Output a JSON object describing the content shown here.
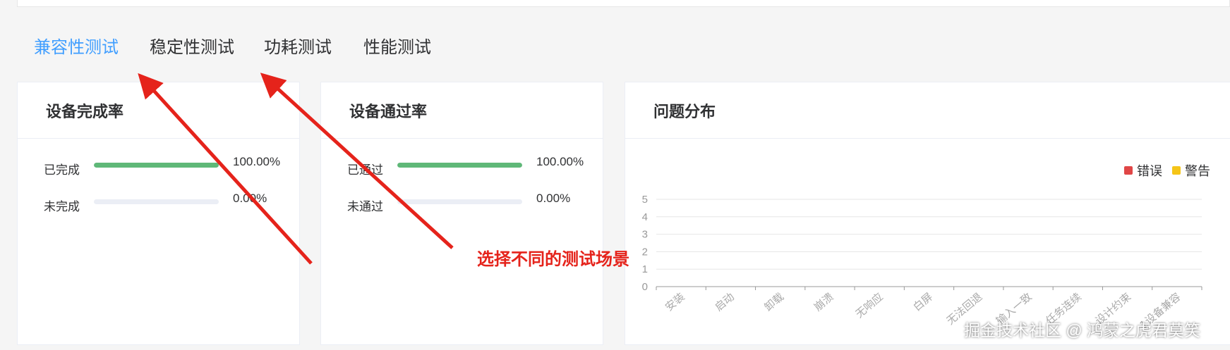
{
  "tabs": [
    {
      "label": "兼容性测试",
      "active": true
    },
    {
      "label": "稳定性测试",
      "active": false
    },
    {
      "label": "功耗测试",
      "active": false
    },
    {
      "label": "性能测试",
      "active": false
    }
  ],
  "completion_card": {
    "title": "设备完成率",
    "rows": [
      {
        "label": "已完成",
        "percent_text": "100.00%",
        "value": 100
      },
      {
        "label": "未完成",
        "percent_text": "0.00%",
        "value": 0
      }
    ]
  },
  "pass_card": {
    "title": "设备通过率",
    "rows": [
      {
        "label": "已通过",
        "percent_text": "100.00%",
        "value": 100
      },
      {
        "label": "未通过",
        "percent_text": "0.00%",
        "value": 0
      }
    ]
  },
  "issue_card": {
    "title": "问题分布",
    "legend": [
      {
        "name": "错误",
        "color": "#e04646"
      },
      {
        "name": "警告",
        "color": "#f5c518"
      }
    ]
  },
  "chart_data": {
    "type": "bar",
    "categories": [
      "安装",
      "启动",
      "卸载",
      "崩溃",
      "无响应",
      "白屏",
      "无法回退",
      "输入一致",
      "任务连续",
      "设计约束",
      "1设备兼容"
    ],
    "series": [
      {
        "name": "错误",
        "values": [
          0,
          0,
          0,
          0,
          0,
          0,
          0,
          0,
          0,
          0,
          0
        ]
      },
      {
        "name": "警告",
        "values": [
          0,
          0,
          0,
          0,
          0,
          0,
          0,
          0,
          0,
          0,
          0
        ]
      }
    ],
    "yticks": [
      0,
      1,
      2,
      3,
      4,
      5
    ],
    "ylim": [
      0,
      5
    ],
    "grid": true,
    "legend_position": "top-right"
  },
  "annotation": {
    "text": "选择不同的测试场景",
    "color": "#e5231b"
  },
  "watermark": {
    "text": "掘金技术社区 @ 鸿蒙之虎君莫笑"
  },
  "colors": {
    "accent": "#409eff",
    "progress": "#5fb878",
    "track": "#ebeef5"
  }
}
